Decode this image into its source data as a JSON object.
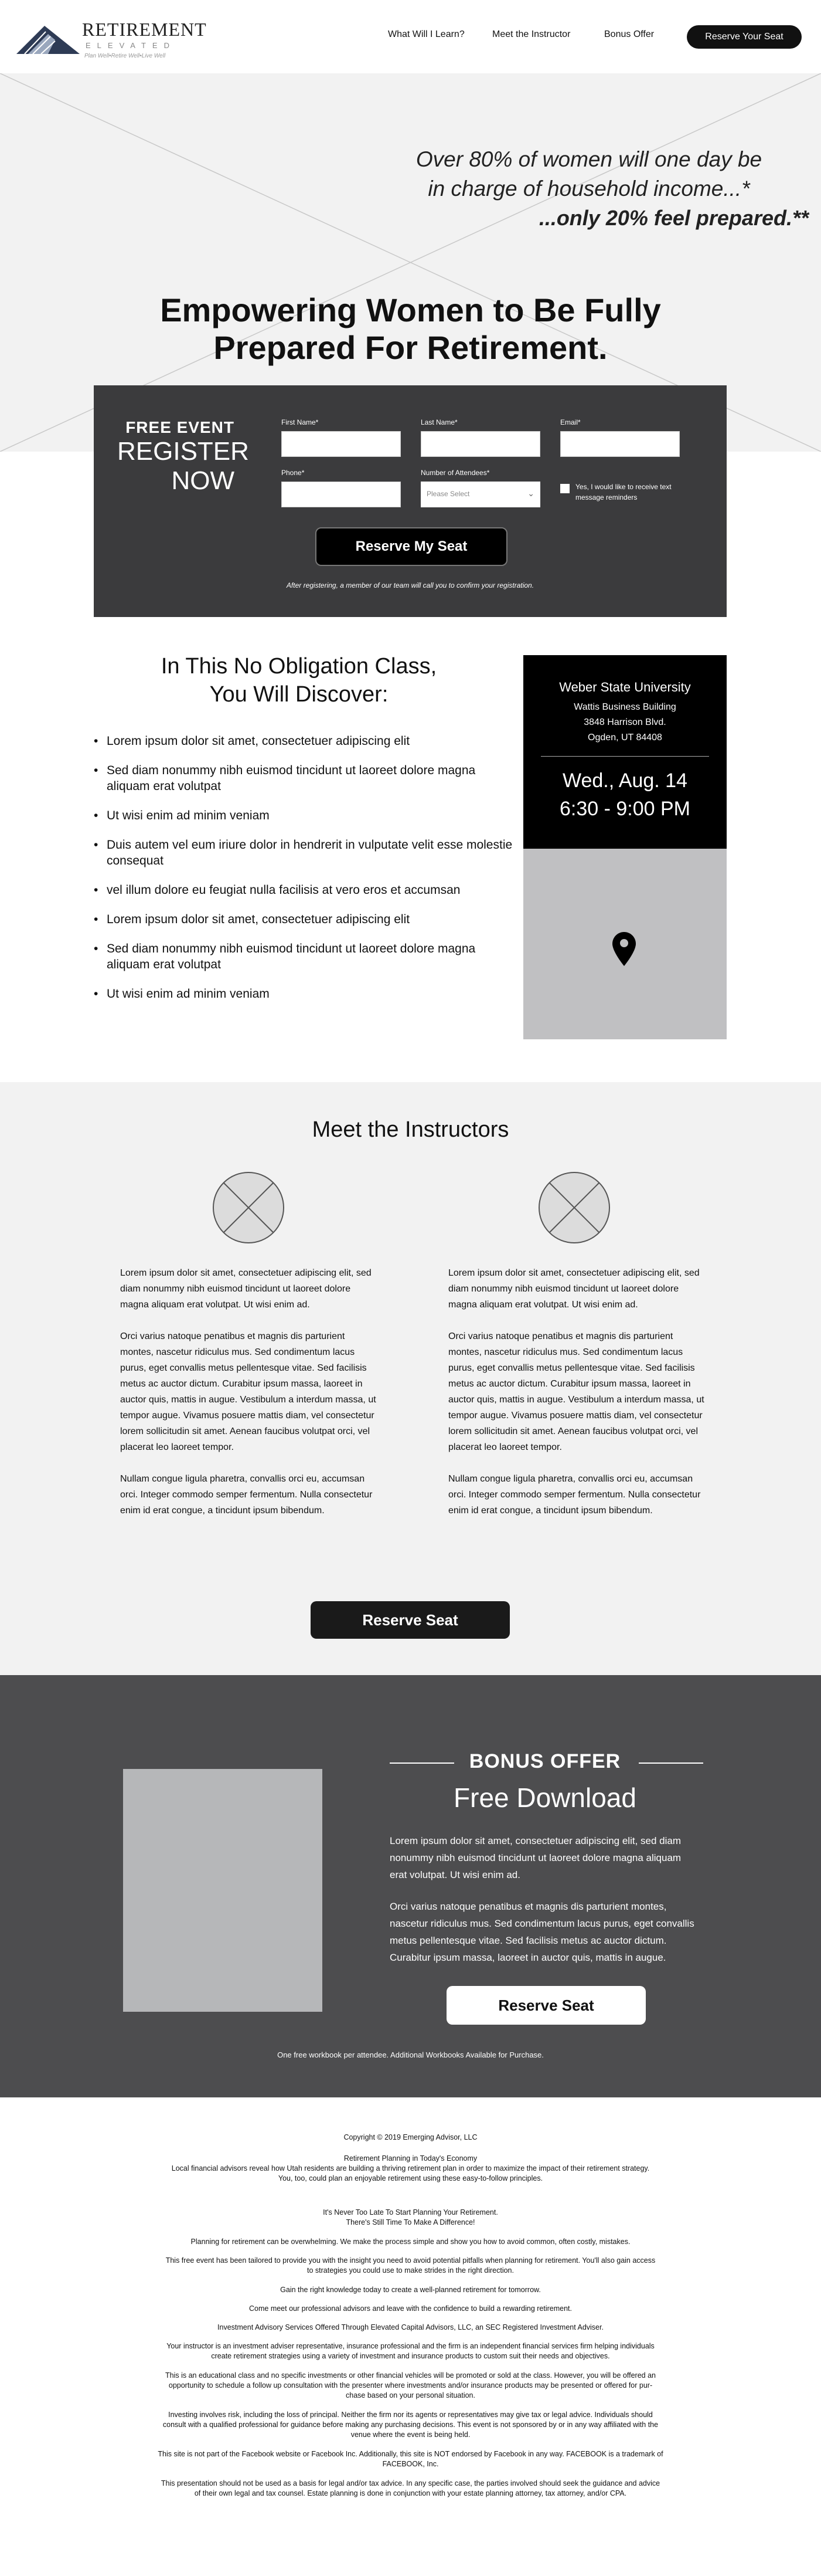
{
  "header": {
    "logo_title": "RETIREMENT",
    "logo_sub": "ELEVATED",
    "logo_tagline": "Plan Well•Retire Well•Live Well",
    "nav": [
      "What Will I Learn?",
      "Meet the Instructor",
      "Bonus Offer"
    ],
    "cta": "Reserve Your Seat"
  },
  "hero": {
    "quote_line1": "Over 80% of women will one day be",
    "quote_line2": "in charge of household income...*",
    "quote_emph": "...only 20% feel prepared.**",
    "title_line1": "Empowering Women to Be Fully",
    "title_line2": "Prepared For Retirement."
  },
  "form": {
    "free_event": "FREE EVENT",
    "register": "REGISTER",
    "now": "NOW",
    "first_name_label": "First Name*",
    "last_name_label": "Last Name*",
    "email_label": "Email*",
    "phone_label": "Phone*",
    "attendees_label": "Number of Attendees*",
    "attendees_placeholder": "Please Select",
    "text_optin": "Yes, I would like to receive text message reminders",
    "submit": "Reserve My Seat",
    "note": "After registering, a member of our team will call you to confirm your registration."
  },
  "class": {
    "title_line1": "In This No Obligation Class,",
    "title_line2": "You Will Discover:",
    "bullets": [
      "Lorem ipsum dolor sit amet, consectetuer adipiscing elit",
      "Sed diam nonummy nibh euismod tincidunt ut laoreet dolore magna aliquam erat volutpat",
      "Ut wisi enim ad minim veniam",
      "Duis autem vel eum iriure dolor in hendrerit in vulputate velit esse molestie consequat",
      "vel illum dolore eu feugiat nulla facilisis at vero eros et accumsan",
      "Lorem ipsum dolor sit amet, consectetuer adipiscing elit",
      "Sed diam nonummy nibh euismod tincidunt ut laoreet dolore magna aliquam erat volutpat",
      "Ut wisi enim ad minim veniam"
    ]
  },
  "event": {
    "venue": "Weber State University",
    "building": "Wattis Business Building",
    "street": "3848 Harrison Blvd.",
    "city": "Ogden, UT 84408",
    "date": "Wed., Aug. 14",
    "time": "6:30 - 9:00 PM"
  },
  "instructors": {
    "title": "Meet the Instructors",
    "bio_p1": "Lorem ipsum dolor sit amet, consectetuer adipiscing elit, sed diam nonummy nibh euismod tincidunt ut laoreet dolore magna aliquam erat volutpat. Ut wisi enim ad.",
    "bio_p2": "Orci varius natoque penatibus et magnis dis parturient montes, nascetur ridiculus mus. Sed condimentum lacus purus, eget convallis metus pellentesque vitae. Sed facilisis metus ac auctor dictum. Curabitur ipsum massa, laoreet in auctor quis, mattis in augue. Vestibulum a interdum massa, ut tempor augue. Vivamus posuere mattis diam, vel consectetur lorem sollicitudin sit amet. Aenean faucibus volutpat orci, vel placerat leo laoreet tempor.",
    "bio_p3": "Nullam congue ligula pharetra, convallis orci eu, accumsan orci. Integer commodo semper fermentum. Nulla consectetur enim id erat congue, a tincidunt ipsum bibendum.",
    "cta": "Reserve Seat"
  },
  "bonus": {
    "label": "BONUS OFFER",
    "subtitle": "Free Download",
    "p1": "Lorem ipsum dolor sit amet, consectetuer adipiscing elit, sed diam nonummy nibh euismod tincidunt ut laoreet dolore magna aliquam erat volutpat. Ut wisi enim ad.",
    "p2": "Orci varius natoque penatibus et magnis dis parturient montes, nascetur ridiculus mus. Sed condimentum lacus purus, eget convallis metus pellentesque vitae. Sed facilisis metus ac auctor dictum. Curabitur ipsum massa, laoreet in auctor quis, mattis in augue.",
    "cta": "Reserve Seat",
    "note": "One free workbook per attendee. Additional Workbooks Available for Purchase."
  },
  "footer": {
    "copyright": "Copyright © 2019 Emerging Advisor, LLC",
    "line1": "Retirement Planning in Today's Economy",
    "line2": "Local financial advisors reveal how Utah residents are building a thriving retirement plan in order to maximize the impact of their retirement strategy.",
    "line3": "You, too, could plan an enjoyable retirement using these easy-to-follow principles.",
    "line4": "It's Never Too Late To Start Planning Your Retirement.",
    "line5": "There's Still Time To Make A Difference!",
    "line6": "Planning for retirement can be overwhelming. We make the process simple and show you how to avoid common, often costly, mistakes.",
    "line7": "This free event has been tailored to provide you with the insight you need to avoid potential pitfalls when planning for retirement. You'll also gain access",
    "line8": "to strategies you could use to make strides in the right direction.",
    "line9": "Gain the right knowledge today to create a well-planned retirement for tomorrow.",
    "line10": "Come meet our professional advisors and leave with the confidence to build a rewarding retirement.",
    "line11": "Investment Advisory Services Offered Through Elevated Capital Advisors, LLC, an SEC Registered Investment Adviser.",
    "line12": "Your instructor is an investment adviser representative, insurance professional and the firm is an independent financial services firm helping individuals",
    "line13": "create retirement strategies using a variety of investment and insurance products to custom suit their needs and objectives.",
    "line14": "This is an educational class and no specific investments or other financial vehicles will be promoted or sold at the class. However, you will be offered an",
    "line15": "opportunity to schedule a follow up consultation with the presenter where investments and/or insurance products may be presented or offered for pur-",
    "line16": "chase based on your personal situation.",
    "line17": "Investing involves risk, including the loss of principal. Neither the firm nor its agents or representatives may give tax or legal advice. Individuals should",
    "line18": "consult with a qualified professional for guidance before making any purchasing decisions. This event is not sponsored by or in any way affiliated with the",
    "line19": "venue where the event is being held.",
    "line20": "This site is not part of the Facebook website or Facebook Inc. Additionally, this site is NOT endorsed by Facebook in any way. FACEBOOK is a trademark of",
    "line21": "FACEBOOK, Inc.",
    "line22": "This presentation should not be used as a basis for legal and/or tax advice. In any specific case, the parties involved should seek the guidance and advice",
    "line23": "of their own legal and tax counsel. Estate planning is done in conjunction with your estate planning attorney, tax attorney, and/or CPA."
  }
}
